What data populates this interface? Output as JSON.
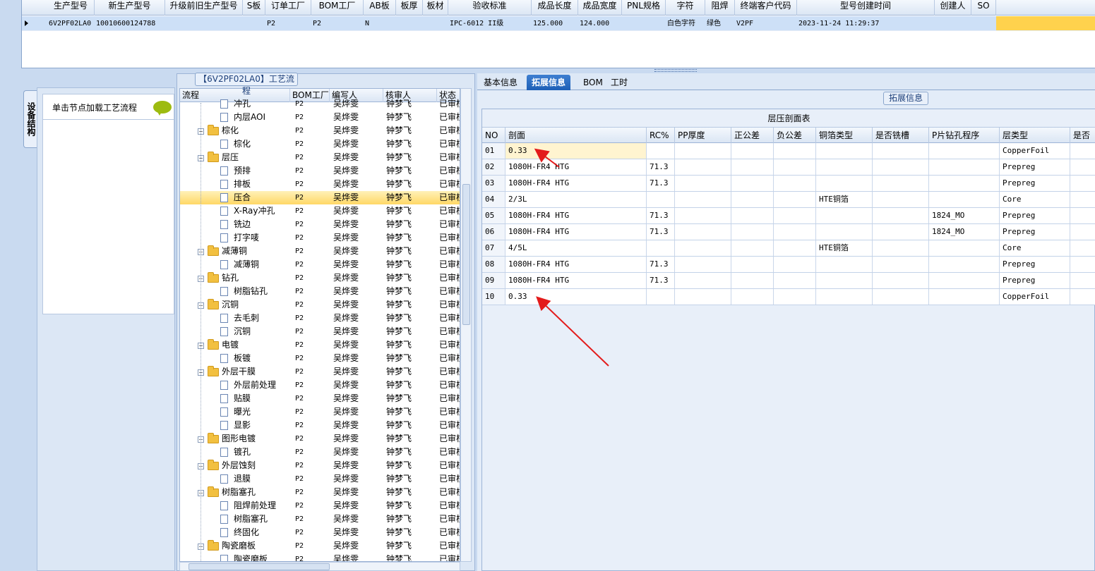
{
  "top_grid": {
    "columns": [
      "生产型号",
      "新生产型号",
      "升级前旧生产型号",
      "S板",
      "订单工厂",
      "BOM工厂",
      "AB板",
      "板厚",
      "板材",
      "验收标准",
      "成品长度",
      "成品宽度",
      "PNL规格",
      "字符",
      "阻焊",
      "终端客户代码",
      "型号创建时间",
      "创建人",
      "SO"
    ],
    "row": [
      "6V2PF02LA0",
      "10010600124788",
      "",
      "",
      "P2",
      "P2",
      "N",
      "",
      "",
      "IPC-6012 II级",
      "125.000",
      "124.000",
      "",
      "白色字符",
      "绿色",
      "V2PF",
      "2023-11-24 11:29:37",
      "",
      ""
    ]
  },
  "side_tab": {
    "label": "设备结构"
  },
  "hint": {
    "text": "单击节点加载工艺流程",
    "icon": "chat-bubble-icon"
  },
  "process": {
    "title": "【6V2PF02LA0】工艺流程",
    "columns": [
      "流程",
      "BOM工厂",
      "编写人",
      "核审人",
      "状态"
    ],
    "rows": [
      {
        "name": "冲孔",
        "level": 2,
        "bom": "P2",
        "author": "吴烨雯",
        "reviewer": "钟梦飞",
        "status": "已审核"
      },
      {
        "name": "内层AOI",
        "level": 2,
        "bom": "P2",
        "author": "吴烨雯",
        "reviewer": "钟梦飞",
        "status": "已审核"
      },
      {
        "name": "棕化",
        "level": 1,
        "bom": "P2",
        "author": "吴烨雯",
        "reviewer": "钟梦飞",
        "status": "已审核"
      },
      {
        "name": "棕化",
        "level": 2,
        "bom": "P2",
        "author": "吴烨雯",
        "reviewer": "钟梦飞",
        "status": "已审核"
      },
      {
        "name": "层压",
        "level": 1,
        "bom": "P2",
        "author": "吴烨雯",
        "reviewer": "钟梦飞",
        "status": "已审核"
      },
      {
        "name": "预排",
        "level": 2,
        "bom": "P2",
        "author": "吴烨雯",
        "reviewer": "钟梦飞",
        "status": "已审核"
      },
      {
        "name": "排板",
        "level": 2,
        "bom": "P2",
        "author": "吴烨雯",
        "reviewer": "钟梦飞",
        "status": "已审核"
      },
      {
        "name": "压合",
        "level": 2,
        "bom": "P2",
        "author": "吴烨雯",
        "reviewer": "钟梦飞",
        "status": "已审核",
        "selected": true
      },
      {
        "name": "X-Ray冲孔",
        "level": 2,
        "bom": "P2",
        "author": "吴烨雯",
        "reviewer": "钟梦飞",
        "status": "已审核"
      },
      {
        "name": "铣边",
        "level": 2,
        "bom": "P2",
        "author": "吴烨雯",
        "reviewer": "钟梦飞",
        "status": "已审核"
      },
      {
        "name": "打字唛",
        "level": 2,
        "bom": "P2",
        "author": "吴烨雯",
        "reviewer": "钟梦飞",
        "status": "已审核"
      },
      {
        "name": "减薄铜",
        "level": 1,
        "bom": "P2",
        "author": "吴烨雯",
        "reviewer": "钟梦飞",
        "status": "已审核"
      },
      {
        "name": "减薄铜",
        "level": 2,
        "bom": "P2",
        "author": "吴烨雯",
        "reviewer": "钟梦飞",
        "status": "已审核"
      },
      {
        "name": "钻孔",
        "level": 1,
        "bom": "P2",
        "author": "吴烨雯",
        "reviewer": "钟梦飞",
        "status": "已审核"
      },
      {
        "name": "树脂钻孔",
        "level": 2,
        "bom": "P2",
        "author": "吴烨雯",
        "reviewer": "钟梦飞",
        "status": "已审核"
      },
      {
        "name": "沉铜",
        "level": 1,
        "bom": "P2",
        "author": "吴烨雯",
        "reviewer": "钟梦飞",
        "status": "已审核"
      },
      {
        "name": "去毛刺",
        "level": 2,
        "bom": "P2",
        "author": "吴烨雯",
        "reviewer": "钟梦飞",
        "status": "已审核"
      },
      {
        "name": "沉铜",
        "level": 2,
        "bom": "P2",
        "author": "吴烨雯",
        "reviewer": "钟梦飞",
        "status": "已审核"
      },
      {
        "name": "电镀",
        "level": 1,
        "bom": "P2",
        "author": "吴烨雯",
        "reviewer": "钟梦飞",
        "status": "已审核"
      },
      {
        "name": "板镀",
        "level": 2,
        "bom": "P2",
        "author": "吴烨雯",
        "reviewer": "钟梦飞",
        "status": "已审核"
      },
      {
        "name": "外层干膜",
        "level": 1,
        "bom": "P2",
        "author": "吴烨雯",
        "reviewer": "钟梦飞",
        "status": "已审核"
      },
      {
        "name": "外层前处理",
        "level": 2,
        "bom": "P2",
        "author": "吴烨雯",
        "reviewer": "钟梦飞",
        "status": "已审核"
      },
      {
        "name": "贴膜",
        "level": 2,
        "bom": "P2",
        "author": "吴烨雯",
        "reviewer": "钟梦飞",
        "status": "已审核"
      },
      {
        "name": "曝光",
        "level": 2,
        "bom": "P2",
        "author": "吴烨雯",
        "reviewer": "钟梦飞",
        "status": "已审核"
      },
      {
        "name": "显影",
        "level": 2,
        "bom": "P2",
        "author": "吴烨雯",
        "reviewer": "钟梦飞",
        "status": "已审核"
      },
      {
        "name": "图形电镀",
        "level": 1,
        "bom": "P2",
        "author": "吴烨雯",
        "reviewer": "钟梦飞",
        "status": "已审核"
      },
      {
        "name": "镀孔",
        "level": 2,
        "bom": "P2",
        "author": "吴烨雯",
        "reviewer": "钟梦飞",
        "status": "已审核"
      },
      {
        "name": "外层蚀刻",
        "level": 1,
        "bom": "P2",
        "author": "吴烨雯",
        "reviewer": "钟梦飞",
        "status": "已审核"
      },
      {
        "name": "退膜",
        "level": 2,
        "bom": "P2",
        "author": "吴烨雯",
        "reviewer": "钟梦飞",
        "status": "已审核"
      },
      {
        "name": "树脂塞孔",
        "level": 1,
        "bom": "P2",
        "author": "吴烨雯",
        "reviewer": "钟梦飞",
        "status": "已审核"
      },
      {
        "name": "阻焊前处理",
        "level": 2,
        "bom": "P2",
        "author": "吴烨雯",
        "reviewer": "钟梦飞",
        "status": "已审核"
      },
      {
        "name": "树脂塞孔",
        "level": 2,
        "bom": "P2",
        "author": "吴烨雯",
        "reviewer": "钟梦飞",
        "status": "已审核"
      },
      {
        "name": "终固化",
        "level": 2,
        "bom": "P2",
        "author": "吴烨雯",
        "reviewer": "钟梦飞",
        "status": "已审核"
      },
      {
        "name": "陶瓷磨板",
        "level": 1,
        "bom": "P2",
        "author": "吴烨雯",
        "reviewer": "钟梦飞",
        "status": "已审核"
      },
      {
        "name": "陶瓷磨板",
        "level": 2,
        "bom": "P2",
        "author": "吴烨雯",
        "reviewer": "钟梦飞",
        "status": "已审核"
      }
    ]
  },
  "right_tabs": {
    "tabs": [
      {
        "label": "基本信息"
      },
      {
        "label": "拓展信息",
        "active": true
      },
      {
        "label": "BOM"
      },
      {
        "label": "工时"
      }
    ]
  },
  "ext": {
    "group_title": "拓展信息",
    "table_caption": "层压剖面表",
    "columns": [
      "NO",
      "剖面",
      "RC%",
      "PP厚度",
      "正公差",
      "负公差",
      "铜箔类型",
      "是否铣槽",
      "P片钻孔程序",
      "层类型",
      "是否"
    ],
    "rows": [
      [
        "01",
        "0.33",
        "",
        "",
        "",
        "",
        "",
        "",
        "",
        "CopperFoil",
        ""
      ],
      [
        "02",
        "1080H-FR4 HTG",
        "71.3",
        "",
        "",
        "",
        "",
        "",
        "",
        "Prepreg",
        ""
      ],
      [
        "03",
        "1080H-FR4 HTG",
        "71.3",
        "",
        "",
        "",
        "",
        "",
        "",
        "Prepreg",
        ""
      ],
      [
        "04",
        "2/3L",
        "",
        "",
        "",
        "",
        "HTE铜箔",
        "",
        "",
        "Core",
        ""
      ],
      [
        "05",
        "1080H-FR4 HTG",
        "71.3",
        "",
        "",
        "",
        "",
        "",
        "1824_MO",
        "Prepreg",
        ""
      ],
      [
        "06",
        "1080H-FR4 HTG",
        "71.3",
        "",
        "",
        "",
        "",
        "",
        "1824_MO",
        "Prepreg",
        ""
      ],
      [
        "07",
        "4/5L",
        "",
        "",
        "",
        "",
        "HTE铜箔",
        "",
        "",
        "Core",
        ""
      ],
      [
        "08",
        "1080H-FR4 HTG",
        "71.3",
        "",
        "",
        "",
        "",
        "",
        "",
        "Prepreg",
        ""
      ],
      [
        "09",
        "1080H-FR4 HTG",
        "71.3",
        "",
        "",
        "",
        "",
        "",
        "",
        "Prepreg",
        ""
      ],
      [
        "10",
        "0.33",
        "",
        "",
        "",
        "",
        "",
        "",
        "",
        "CopperFoil",
        ""
      ]
    ]
  },
  "colors": {
    "selected_row": "#ffd866",
    "accent": "#1d5fb6",
    "arrow": "#e31b1b"
  }
}
